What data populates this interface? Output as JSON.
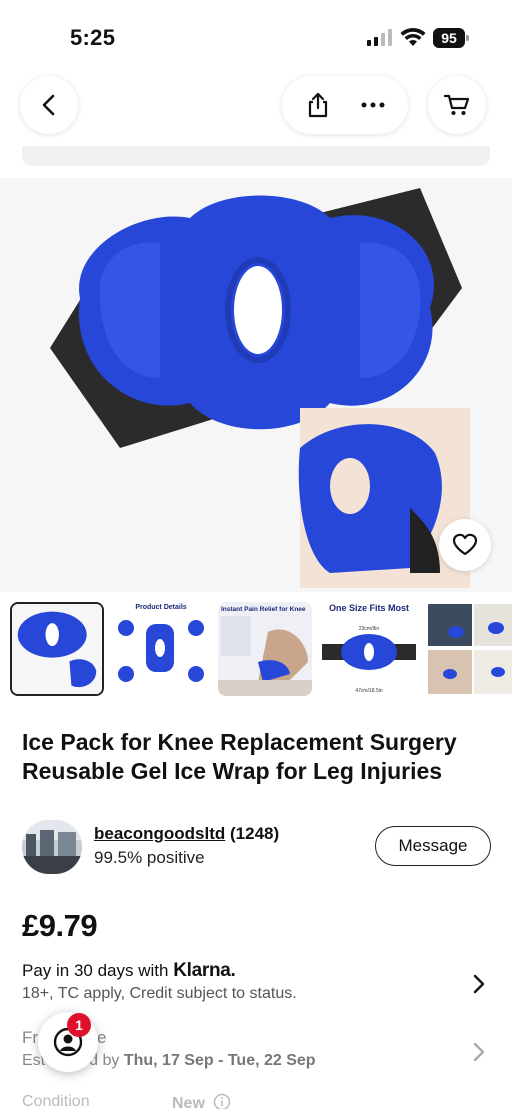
{
  "status_bar": {
    "time": "5:25",
    "battery": "95"
  },
  "nav": {
    "back_icon": "chevron-left-icon",
    "share_icon": "share-icon",
    "more_icon": "more-dots-icon",
    "cart_icon": "cart-icon"
  },
  "listing": {
    "title": "Ice Pack for Knee Replacement Surgery Reusable Gel Ice Wrap for Leg Injuries",
    "price": "£9.79"
  },
  "thumbnails": [
    {
      "label": ""
    },
    {
      "label": "Product Details"
    },
    {
      "label": "Instant Pain Relief for Knee"
    },
    {
      "label": "One Size Fits Most",
      "dim1": "23cm/9in",
      "dim2": "47cm/18.5in"
    },
    {
      "label": ""
    }
  ],
  "seller": {
    "name": "beacongoodsltd",
    "count": "(1248)",
    "feedback": "99.5% positive",
    "message_label": "Message"
  },
  "payment": {
    "prefix": "Pay in 30 days with",
    "provider": "Klarna.",
    "terms": "18+, TC apply, Credit subject to status."
  },
  "shipping": {
    "line1_start": "Fr",
    "line1_end": "age",
    "line2_start": "Est",
    "line2_mid": "d by",
    "dates": "Thu, 17 Sep - Tue, 22 Sep"
  },
  "condition": {
    "label": "Condition",
    "value": "New"
  },
  "assistant": {
    "badge": "1"
  },
  "colors": {
    "accent_blue": "#2747d8",
    "badge_red": "#e0102a"
  }
}
